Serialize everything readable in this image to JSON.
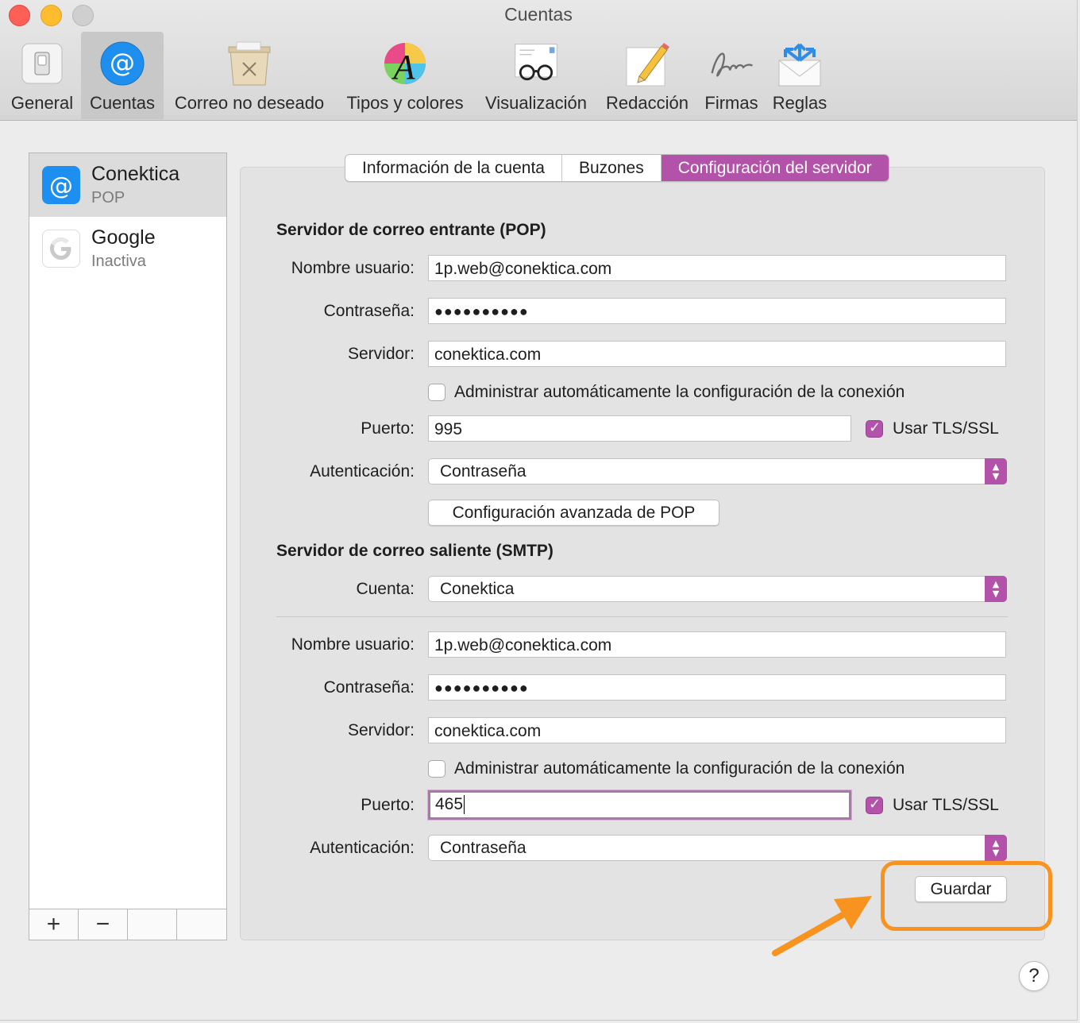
{
  "window": {
    "title": "Cuentas"
  },
  "toolbar": {
    "items": [
      {
        "label": "General",
        "icon": "general-switch-icon"
      },
      {
        "label": "Cuentas",
        "icon": "at-sign-icon"
      },
      {
        "label": "Correo no deseado",
        "icon": "junk-trash-icon"
      },
      {
        "label": "Tipos y colores",
        "icon": "font-color-wheel-icon"
      },
      {
        "label": "Visualización",
        "icon": "glasses-letter-icon"
      },
      {
        "label": "Redacción",
        "icon": "pencil-paper-icon"
      },
      {
        "label": "Firmas",
        "icon": "signature-icon"
      },
      {
        "label": "Reglas",
        "icon": "rules-envelope-icon"
      }
    ],
    "active": "Cuentas"
  },
  "sidebar": {
    "accounts": [
      {
        "name": "Conektica",
        "subtitle": "POP",
        "icon": "at-sign-icon",
        "selected": true
      },
      {
        "name": "Google",
        "subtitle": "Inactiva",
        "icon": "google-g-icon",
        "selected": false
      }
    ],
    "add_label": "+",
    "remove_label": "−"
  },
  "tabs": {
    "items": [
      "Información de la cuenta",
      "Buzones",
      "Configuración del servidor"
    ],
    "active": "Configuración del servidor"
  },
  "incoming": {
    "title": "Servidor de correo entrante (POP)",
    "username_label": "Nombre usuario:",
    "username": "1p.web@conektica.com",
    "password_label": "Contraseña:",
    "password_mask": "●●●●●●●●●●",
    "server_label": "Servidor:",
    "server": "conektica.com",
    "auto_manage_label": "Administrar automáticamente la configuración de la conexión",
    "auto_manage_checked": false,
    "port_label": "Puerto:",
    "port": "995",
    "tls_label": "Usar TLS/SSL",
    "tls_checked": true,
    "auth_label": "Autenticación:",
    "auth_value": "Contraseña",
    "advanced_button": "Configuración avanzada de POP"
  },
  "outgoing": {
    "title": "Servidor de correo saliente (SMTP)",
    "account_label": "Cuenta:",
    "account_value": "Conektica",
    "username_label": "Nombre usuario:",
    "username": "1p.web@conektica.com",
    "password_label": "Contraseña:",
    "password_mask": "●●●●●●●●●●",
    "server_label": "Servidor:",
    "server": "conektica.com",
    "auto_manage_label": "Administrar automáticamente la configuración de la conexión",
    "auto_manage_checked": false,
    "port_label": "Puerto:",
    "port": "465",
    "tls_label": "Usar TLS/SSL",
    "tls_checked": true,
    "auth_label": "Autenticación:",
    "auth_value": "Contraseña"
  },
  "save_button": "Guardar",
  "help_label": "?",
  "colors": {
    "accent": "#b252a8",
    "annotation": "#f7931e"
  }
}
